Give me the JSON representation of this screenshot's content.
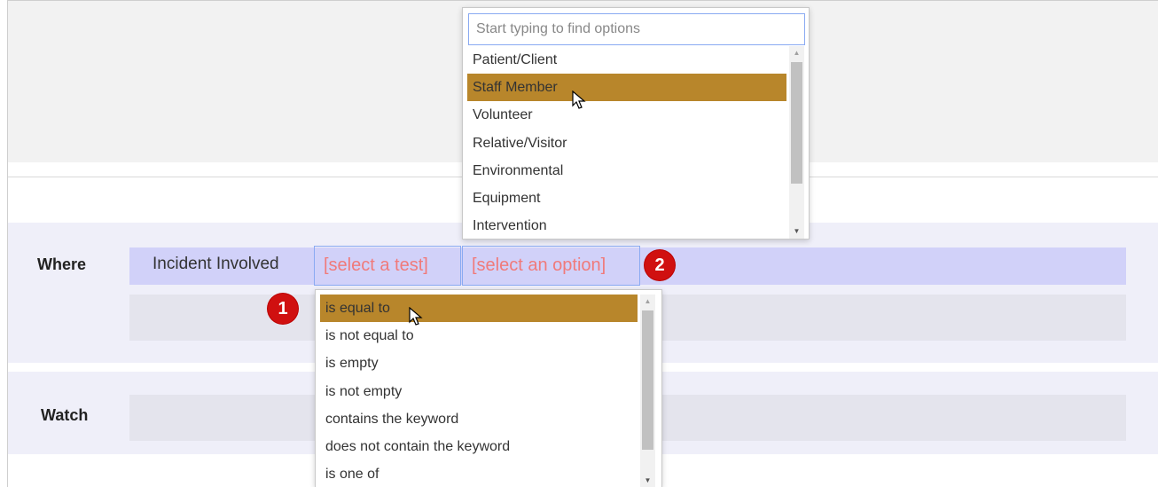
{
  "sections": {
    "where_label": "Where",
    "watch_label": "Watch"
  },
  "condition": {
    "field": "Incident Involved",
    "test_token": "[select a test]",
    "option_token": "[select an option]"
  },
  "badges": {
    "one": "1",
    "two": "2"
  },
  "option_dropdown": {
    "placeholder": "Start typing to find options",
    "items": [
      "Patient/Client",
      "Staff Member",
      "Volunteer",
      "Relative/Visitor",
      "Environmental",
      "Equipment",
      "Intervention"
    ],
    "highlighted": "Staff Member"
  },
  "test_dropdown": {
    "items": [
      "is equal to",
      "is not equal to",
      "is empty",
      "is not empty",
      "contains the keyword",
      "does not contain the keyword",
      "is one of"
    ],
    "highlighted": "is equal to"
  },
  "colors": {
    "highlight": "#b8862b",
    "token_text": "#f07a7a",
    "condition_row": "#d1d1f9",
    "badge": "#d01010"
  },
  "icons": {
    "cursor": "pointer-arrow-icon",
    "scroll_up": "triangle-up-icon",
    "scroll_down": "triangle-down-icon"
  }
}
